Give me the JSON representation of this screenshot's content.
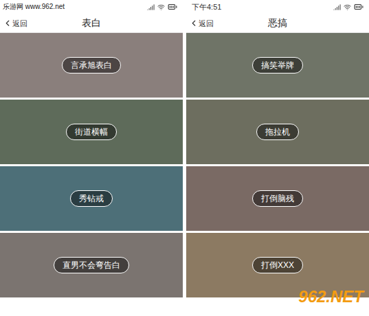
{
  "watermarks": {
    "top": "乐游网 www.962.net",
    "logo": "962.NET",
    "logo_text": "乐游网"
  },
  "screens": [
    {
      "status_bar": {
        "time": ""
      },
      "header": {
        "back": "返回",
        "title": "表白"
      },
      "cards": [
        {
          "label": "言承旭表白",
          "color": "#8a7f7c"
        },
        {
          "label": "街道横幅",
          "color": "#5e6b5a"
        },
        {
          "label": "秀钻戒",
          "color": "#4d6f78"
        },
        {
          "label": "直男不会弯告白",
          "color": "#7b7470"
        }
      ]
    },
    {
      "status_bar": {
        "time": "下午4:51"
      },
      "header": {
        "back": "返回",
        "title": "恶搞"
      },
      "cards": [
        {
          "label": "搞笑举牌",
          "color": "#6f7467"
        },
        {
          "label": "拖拉机",
          "color": "#6d6e5f"
        },
        {
          "label": "打倒脑残",
          "color": "#7a6a64"
        },
        {
          "label": "打倒XXX",
          "color": "#8c7a62"
        }
      ]
    }
  ]
}
